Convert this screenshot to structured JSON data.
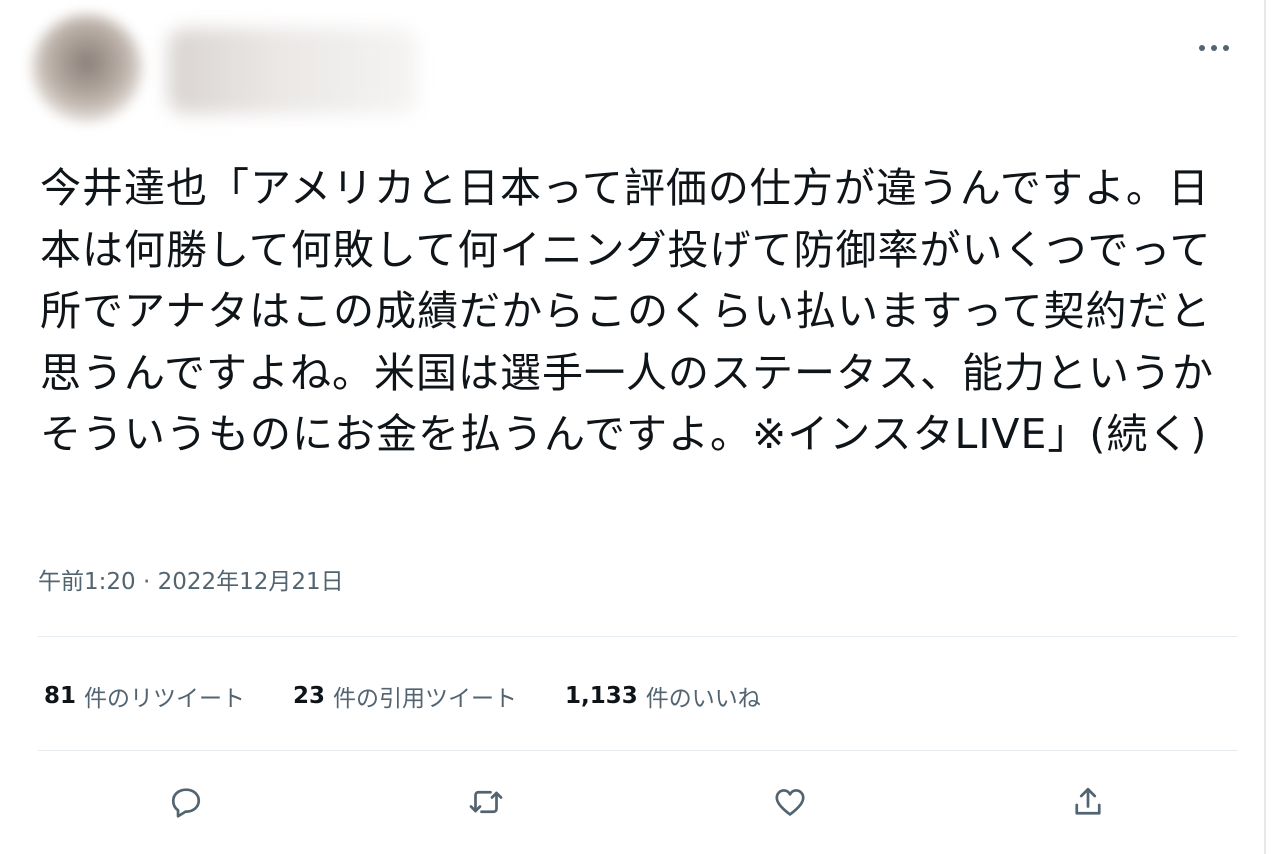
{
  "tweet": {
    "author_name": "",
    "author_handle": "",
    "more_label": "···",
    "text": "今井達也「アメリカと日本って評価の仕方が違うんですよ。日本は何勝して何敗して何イニング投げて防御率がいくつでって所でアナタはこの成績だからこのくらい払いますって契約だと思うんですよね。米国は選手一人のステータス、能力というかそういうものにお金を払うんですよ。※インスタLIVE」(続く)",
    "timestamp": "午前1:20 · 2022年12月21日"
  },
  "stats": {
    "retweets": {
      "count": "81",
      "label": "件のリツイート"
    },
    "quotes": {
      "count": "23",
      "label": "件の引用ツイート"
    },
    "likes": {
      "count": "1,133",
      "label": "件のいいね"
    }
  },
  "actions": [
    {
      "name": "reply",
      "icon": "reply-icon"
    },
    {
      "name": "retweet",
      "icon": "retweet-icon"
    },
    {
      "name": "like",
      "icon": "heart-icon"
    },
    {
      "name": "share",
      "icon": "share-icon"
    }
  ],
  "colors": {
    "text": "#0f1419",
    "secondary": "#536471",
    "divider": "#e6ecf0",
    "icon": "#536471"
  }
}
